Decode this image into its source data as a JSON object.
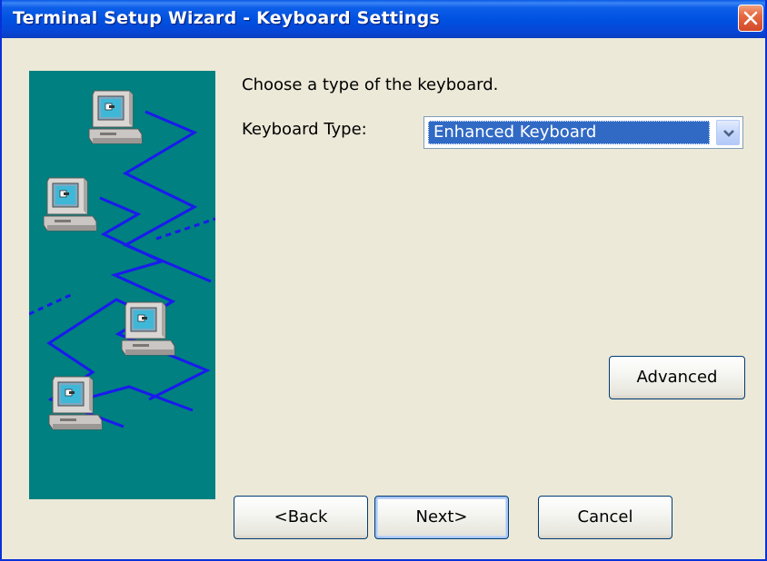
{
  "window": {
    "title": "Terminal Setup Wizard - Keyboard Settings",
    "close_icon": "close-icon"
  },
  "illustration": {
    "icon": "networked-computers-illustration",
    "background_color": "#008080",
    "line_color": "#1a1aee"
  },
  "content": {
    "prompt": "Choose a type of the keyboard.",
    "keyboard_type_label": "Keyboard Type:",
    "keyboard_type_value": "Enhanced Keyboard",
    "dropdown_icon": "chevron-down-icon"
  },
  "buttons": {
    "advanced": "Advanced",
    "back": "<Back",
    "next": "Next>",
    "cancel": "Cancel"
  },
  "colors": {
    "titlebar": "#0050e0",
    "selection": "#316ac5",
    "dialog_bg": "#ece9d8",
    "close_button": "#e5683f"
  }
}
